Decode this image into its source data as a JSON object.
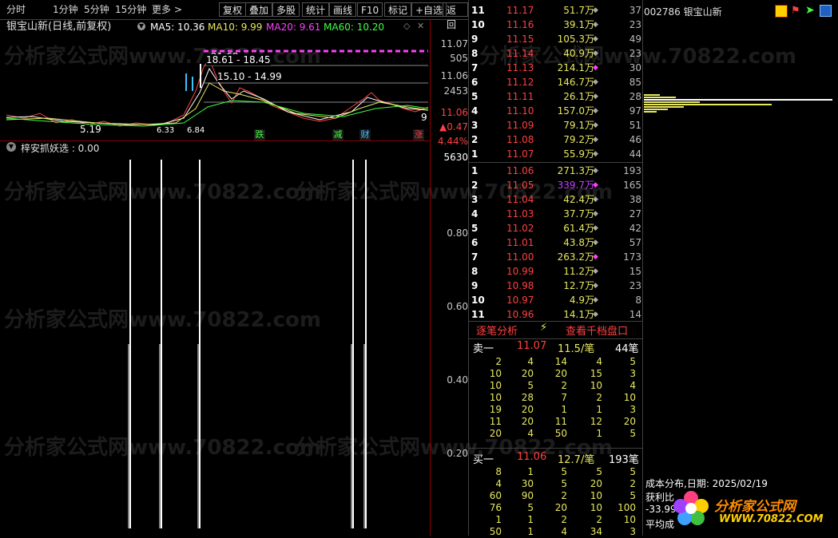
{
  "toolbar": {
    "items": [
      "分时",
      "1分钟",
      "5分钟",
      "15分钟",
      "更多"
    ],
    "more_chevron": ">",
    "buttons": [
      "复权",
      "叠加",
      "多股",
      "统计",
      "画线",
      "F10",
      "标记",
      "+自选",
      "返回"
    ]
  },
  "chart_header": {
    "title": "银宝山新(日线,前复权)",
    "ma5": "MA5: 10.36",
    "ma10": "MA10: 9.99",
    "ma20": "MA20: 9.61",
    "ma60": "MA60: 10.20",
    "ma5_color": "#ffffff",
    "ma10_color": "#e8e860",
    "ma20_color": "#ff40ff",
    "ma60_color": "#40ff40"
  },
  "kline": {
    "annot_high": "21.68",
    "annot_range1": "18.61 - 18.45",
    "annot_range2": "15.10 - 14.99",
    "annot_low": "5.19",
    "annot_d1": "6.33",
    "annot_d2": "6.84",
    "annot_right": "9",
    "tag_die": "跌",
    "tag_jian": "减",
    "tag_cai": "财",
    "tag_zhang": "涨",
    "axis": {
      "p1": "11.07",
      "v1": "505",
      "p2": "11.06",
      "v2": "2453",
      "p3": "11.06",
      "chg": "▲0.47",
      "pct": "4.44%",
      "vol": "5630"
    }
  },
  "indicator": {
    "title": "梓安抓妖选 : 0.00",
    "axis_labels": [
      "0.80",
      "0.60",
      "0.40",
      "0.20"
    ],
    "chart_data": {
      "type": "bar",
      "title": "梓安抓妖选",
      "ylim": [
        0,
        1
      ],
      "ticks": [
        0.8,
        0.6,
        0.4,
        0.2
      ],
      "signals": [
        1,
        1,
        1,
        1,
        1
      ],
      "values_at_signal": [
        1,
        1,
        1,
        1,
        1
      ]
    }
  },
  "orderbook": {
    "asks": [
      {
        "idx": "11",
        "price": "11.17",
        "vol": "51.7万",
        "dot": "◆",
        "cnt": "37"
      },
      {
        "idx": "10",
        "price": "11.16",
        "vol": "39.1万",
        "dot": "◆",
        "cnt": "23"
      },
      {
        "idx": "9",
        "price": "11.15",
        "vol": "105.3万",
        "dot": "◆",
        "cnt": "49"
      },
      {
        "idx": "8",
        "price": "11.14",
        "vol": "40.9万",
        "dot": "◆",
        "cnt": "23"
      },
      {
        "idx": "7",
        "price": "11.13",
        "vol": "214.1万",
        "dot": "◆",
        "cnt": "30"
      },
      {
        "idx": "6",
        "price": "11.12",
        "vol": "146.7万",
        "dot": "◆",
        "cnt": "85"
      },
      {
        "idx": "5",
        "price": "11.11",
        "vol": "26.1万",
        "dot": "◆",
        "cnt": "28"
      },
      {
        "idx": "4",
        "price": "11.10",
        "vol": "157.0万",
        "dot": "◆",
        "cnt": "97"
      },
      {
        "idx": "3",
        "price": "11.09",
        "vol": "79.1万",
        "dot": "◆",
        "cnt": "51"
      },
      {
        "idx": "2",
        "price": "11.08",
        "vol": "79.2万",
        "dot": "◆",
        "cnt": "46"
      },
      {
        "idx": "1",
        "price": "11.07",
        "vol": "55.9万",
        "dot": "◆",
        "cnt": "44"
      }
    ],
    "bids": [
      {
        "idx": "1",
        "price": "11.06",
        "vol": "271.3万",
        "dot": "◆",
        "cnt": "193"
      },
      {
        "idx": "2",
        "price": "11.05",
        "vol": "339.7万",
        "dot": "◆",
        "cnt": "165"
      },
      {
        "idx": "3",
        "price": "11.04",
        "vol": "42.4万",
        "dot": "◆",
        "cnt": "38"
      },
      {
        "idx": "4",
        "price": "11.03",
        "vol": "37.7万",
        "dot": "◆",
        "cnt": "27"
      },
      {
        "idx": "5",
        "price": "11.02",
        "vol": "61.4万",
        "dot": "◆",
        "cnt": "42"
      },
      {
        "idx": "6",
        "price": "11.01",
        "vol": "43.8万",
        "dot": "◆",
        "cnt": "57"
      },
      {
        "idx": "7",
        "price": "11.00",
        "vol": "263.2万",
        "dot": "◆",
        "cnt": "173"
      },
      {
        "idx": "8",
        "price": "10.99",
        "vol": "11.2万",
        "dot": "◆",
        "cnt": "15"
      },
      {
        "idx": "9",
        "price": "10.98",
        "vol": "12.7万",
        "dot": "◆",
        "cnt": "23"
      },
      {
        "idx": "10",
        "price": "10.97",
        "vol": "4.9万",
        "dot": "◆",
        "cnt": "8"
      },
      {
        "idx": "11",
        "price": "10.96",
        "vol": "14.1万",
        "dot": "◆",
        "cnt": "14"
      }
    ]
  },
  "tabs": {
    "analysis": "逐笔分析",
    "bolt": "⚡",
    "thousand": "查看千档盘口"
  },
  "sell1": {
    "label": "卖一",
    "price": "11.07",
    "avg": "11.5/笔",
    "count": "44笔"
  },
  "sell_trades": [
    [
      "2",
      "4",
      "14",
      "4",
      "5"
    ],
    [
      "10",
      "20",
      "20",
      "15",
      "3"
    ],
    [
      "10",
      "5",
      "2",
      "10",
      "4"
    ],
    [
      "10",
      "28",
      "7",
      "2",
      "10"
    ],
    [
      "19",
      "20",
      "1",
      "1",
      "3"
    ],
    [
      "11",
      "20",
      "11",
      "12",
      "20"
    ],
    [
      "20",
      "4",
      "50",
      "1",
      "5"
    ]
  ],
  "buy1": {
    "label": "买一",
    "price": "11.06",
    "avg": "12.7/笔",
    "count": "193笔"
  },
  "buy_trades": [
    [
      "8",
      "1",
      "5",
      "5",
      "5"
    ],
    [
      "4",
      "30",
      "5",
      "20",
      "2"
    ],
    [
      "60",
      "90",
      "2",
      "10",
      "5"
    ],
    [
      "76",
      "5",
      "20",
      "10",
      "100"
    ],
    [
      "1",
      "1",
      "2",
      "2",
      "10"
    ],
    [
      "50",
      "1",
      "4",
      "34",
      "3"
    ]
  ],
  "right_panel": {
    "stock_name": "002786 银宝山新",
    "cost_title": "成本分布,日期: 2025/02/19",
    "profit": "获利比",
    "profit_val": "-33.99",
    "avg": "平均成"
  },
  "watermark": {
    "text1": "分析家公式网www.70822.com",
    "logo_text": "分析家公式网",
    "logo_url": "WWW.70822.COM"
  }
}
